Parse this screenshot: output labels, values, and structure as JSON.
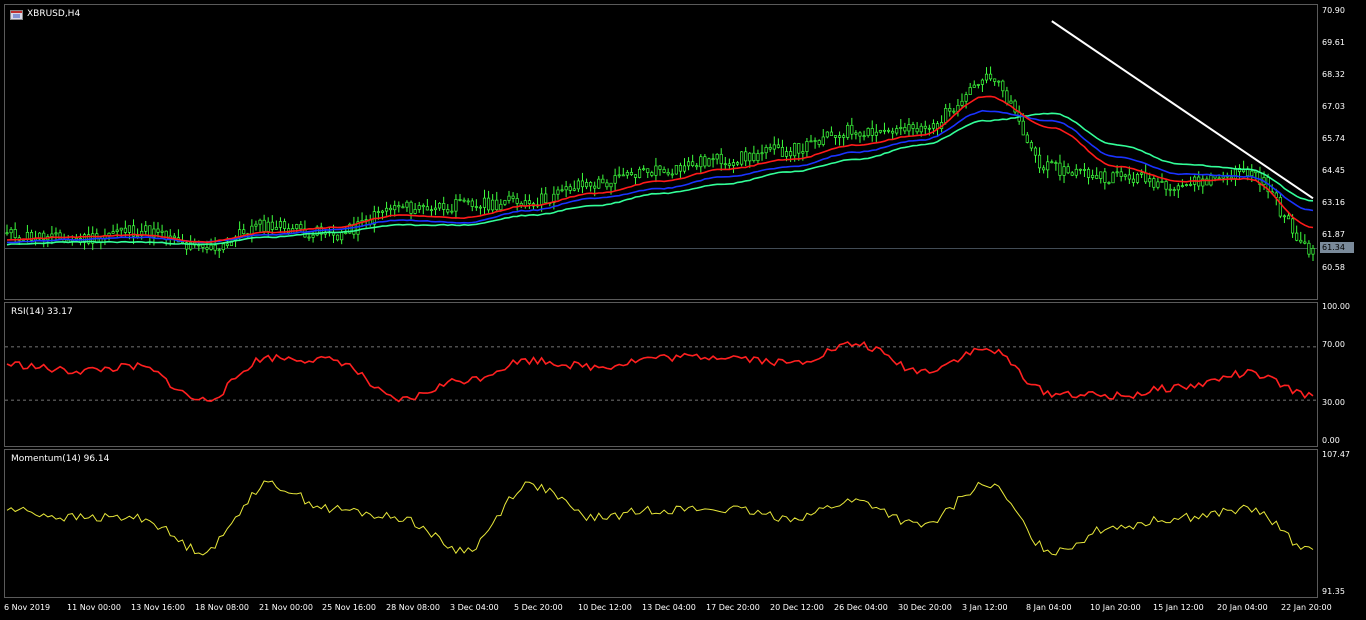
{
  "window": {
    "symbol_title": "XBRUSD,H4",
    "chart_icon": "chart-window-icon"
  },
  "colors": {
    "background": "#000000",
    "candle": "#3dff3d",
    "ma_fast": "#ff1a1a",
    "ma_mid": "#1a33ff",
    "ma_slow": "#33ff99",
    "trendline": "#ffffff",
    "rsi": "#ff2020",
    "momentum": "#e8e83a",
    "grid": "#5a5a5a"
  },
  "main_pane": {
    "y_axis_ticks": [
      "70.90",
      "69.61",
      "68.32",
      "67.03",
      "65.74",
      "64.45",
      "63.16",
      "61.87",
      "60.58"
    ],
    "current_price": "61.34"
  },
  "rsi_pane": {
    "label": "RSI(14) 33.17",
    "y_axis_ticks": [
      "100.00",
      "70.00",
      "30.00",
      "0.00"
    ],
    "levels": [
      70,
      30
    ]
  },
  "momentum_pane": {
    "label": "Momentum(14) 96.14",
    "y_axis_ticks": [
      "107.47",
      "91.35"
    ]
  },
  "x_axis_ticks": [
    "6 Nov 2019",
    "11 Nov 00:00",
    "13 Nov 16:00",
    "18 Nov 08:00",
    "21 Nov 00:00",
    "25 Nov 16:00",
    "28 Nov 08:00",
    "3 Dec 04:00",
    "5 Dec 20:00",
    "10 Dec 12:00",
    "13 Dec 04:00",
    "17 Dec 20:00",
    "20 Dec 12:00",
    "26 Dec 04:00",
    "30 Dec 20:00",
    "3 Jan 12:00",
    "8 Jan 04:00",
    "10 Jan 20:00",
    "15 Jan 12:00",
    "20 Jan 04:00",
    "22 Jan 20:00"
  ],
  "chart_data": [
    {
      "type": "line",
      "title": "XBRUSD,H4",
      "ylim": [
        59.5,
        71.2
      ],
      "x_anchors": [
        "6 Nov 2019",
        "11 Nov 00:00",
        "13 Nov 16:00",
        "18 Nov 08:00",
        "21 Nov 00:00",
        "25 Nov 16:00",
        "28 Nov 08:00",
        "3 Dec 04:00",
        "5 Dec 20:00",
        "10 Dec 12:00",
        "13 Dec 04:00",
        "17 Dec 20:00",
        "20 Dec 12:00",
        "26 Dec 04:00",
        "30 Dec 20:00",
        "3 Jan 12:00",
        "8 Jan 04:00",
        "10 Jan 20:00",
        "15 Jan 12:00",
        "20 Jan 04:00",
        "22 Jan 20:00"
      ],
      "series": [
        {
          "values": [
            61.9,
            61.7,
            62.1,
            61.3,
            62.3,
            61.9,
            63.0,
            63.1,
            63.3,
            64.0,
            64.6,
            65.0,
            65.4,
            66.2,
            66.2,
            68.3,
            64.6,
            64.3,
            64.0,
            64.5,
            61.34
          ]
        },
        {
          "values": [
            61.7,
            61.8,
            61.9,
            61.6,
            62.0,
            62.2,
            62.7,
            62.6,
            63.1,
            63.6,
            64.1,
            64.6,
            65.0,
            65.6,
            66.0,
            67.6,
            66.3,
            64.7,
            64.1,
            64.2,
            62.2
          ]
        },
        {
          "values": [
            61.6,
            61.7,
            61.8,
            61.6,
            61.9,
            62.1,
            62.5,
            62.4,
            62.9,
            63.4,
            63.8,
            64.3,
            64.7,
            65.3,
            65.8,
            67.0,
            66.6,
            65.1,
            64.4,
            64.3,
            62.9
          ]
        },
        {
          "values": [
            61.5,
            61.6,
            61.6,
            61.5,
            61.8,
            62.0,
            62.3,
            62.3,
            62.7,
            63.1,
            63.6,
            64.0,
            64.5,
            65.0,
            65.6,
            66.6,
            66.9,
            65.6,
            64.8,
            64.6,
            63.3
          ]
        }
      ],
      "trendline": {
        "from": [
          "8 Jan 04:00",
          70.7
        ],
        "to": [
          "22 Jan 20:00",
          63.4
        ]
      },
      "price_level": 61.34
    },
    {
      "type": "line",
      "title": "RSI(14) 33.17",
      "ylim": [
        0,
        100
      ],
      "levels": [
        70,
        30
      ],
      "x_anchors": [
        "6 Nov 2019",
        "11 Nov 00:00",
        "13 Nov 16:00",
        "18 Nov 08:00",
        "21 Nov 00:00",
        "25 Nov 16:00",
        "28 Nov 08:00",
        "3 Dec 04:00",
        "5 Dec 20:00",
        "10 Dec 12:00",
        "13 Dec 04:00",
        "17 Dec 20:00",
        "20 Dec 12:00",
        "26 Dec 04:00",
        "30 Dec 20:00",
        "3 Jan 12:00",
        "8 Jan 04:00",
        "10 Jan 20:00",
        "15 Jan 12:00",
        "20 Jan 04:00",
        "22 Jan 20:00"
      ],
      "values": [
        57,
        52,
        55,
        30,
        62,
        60,
        30,
        45,
        60,
        55,
        62,
        63,
        58,
        72,
        52,
        68,
        35,
        33,
        40,
        50,
        33.17
      ]
    },
    {
      "type": "line",
      "title": "Momentum(14) 96.14",
      "ylim": [
        91.35,
        107.47
      ],
      "x_anchors": [
        "6 Nov 2019",
        "11 Nov 00:00",
        "13 Nov 16:00",
        "18 Nov 08:00",
        "21 Nov 00:00",
        "25 Nov 16:00",
        "28 Nov 08:00",
        "3 Dec 04:00",
        "5 Dec 20:00",
        "10 Dec 12:00",
        "13 Dec 04:00",
        "17 Dec 20:00",
        "20 Dec 12:00",
        "26 Dec 04:00",
        "30 Dec 20:00",
        "3 Jan 12:00",
        "8 Jan 04:00",
        "10 Jan 20:00",
        "15 Jan 12:00",
        "20 Jan 04:00",
        "22 Jan 20:00"
      ],
      "values": [
        101,
        100,
        100,
        96,
        104,
        101,
        100,
        96,
        104,
        100,
        101,
        101,
        100,
        102,
        99,
        104,
        96,
        99,
        100,
        101,
        96.14
      ]
    }
  ]
}
